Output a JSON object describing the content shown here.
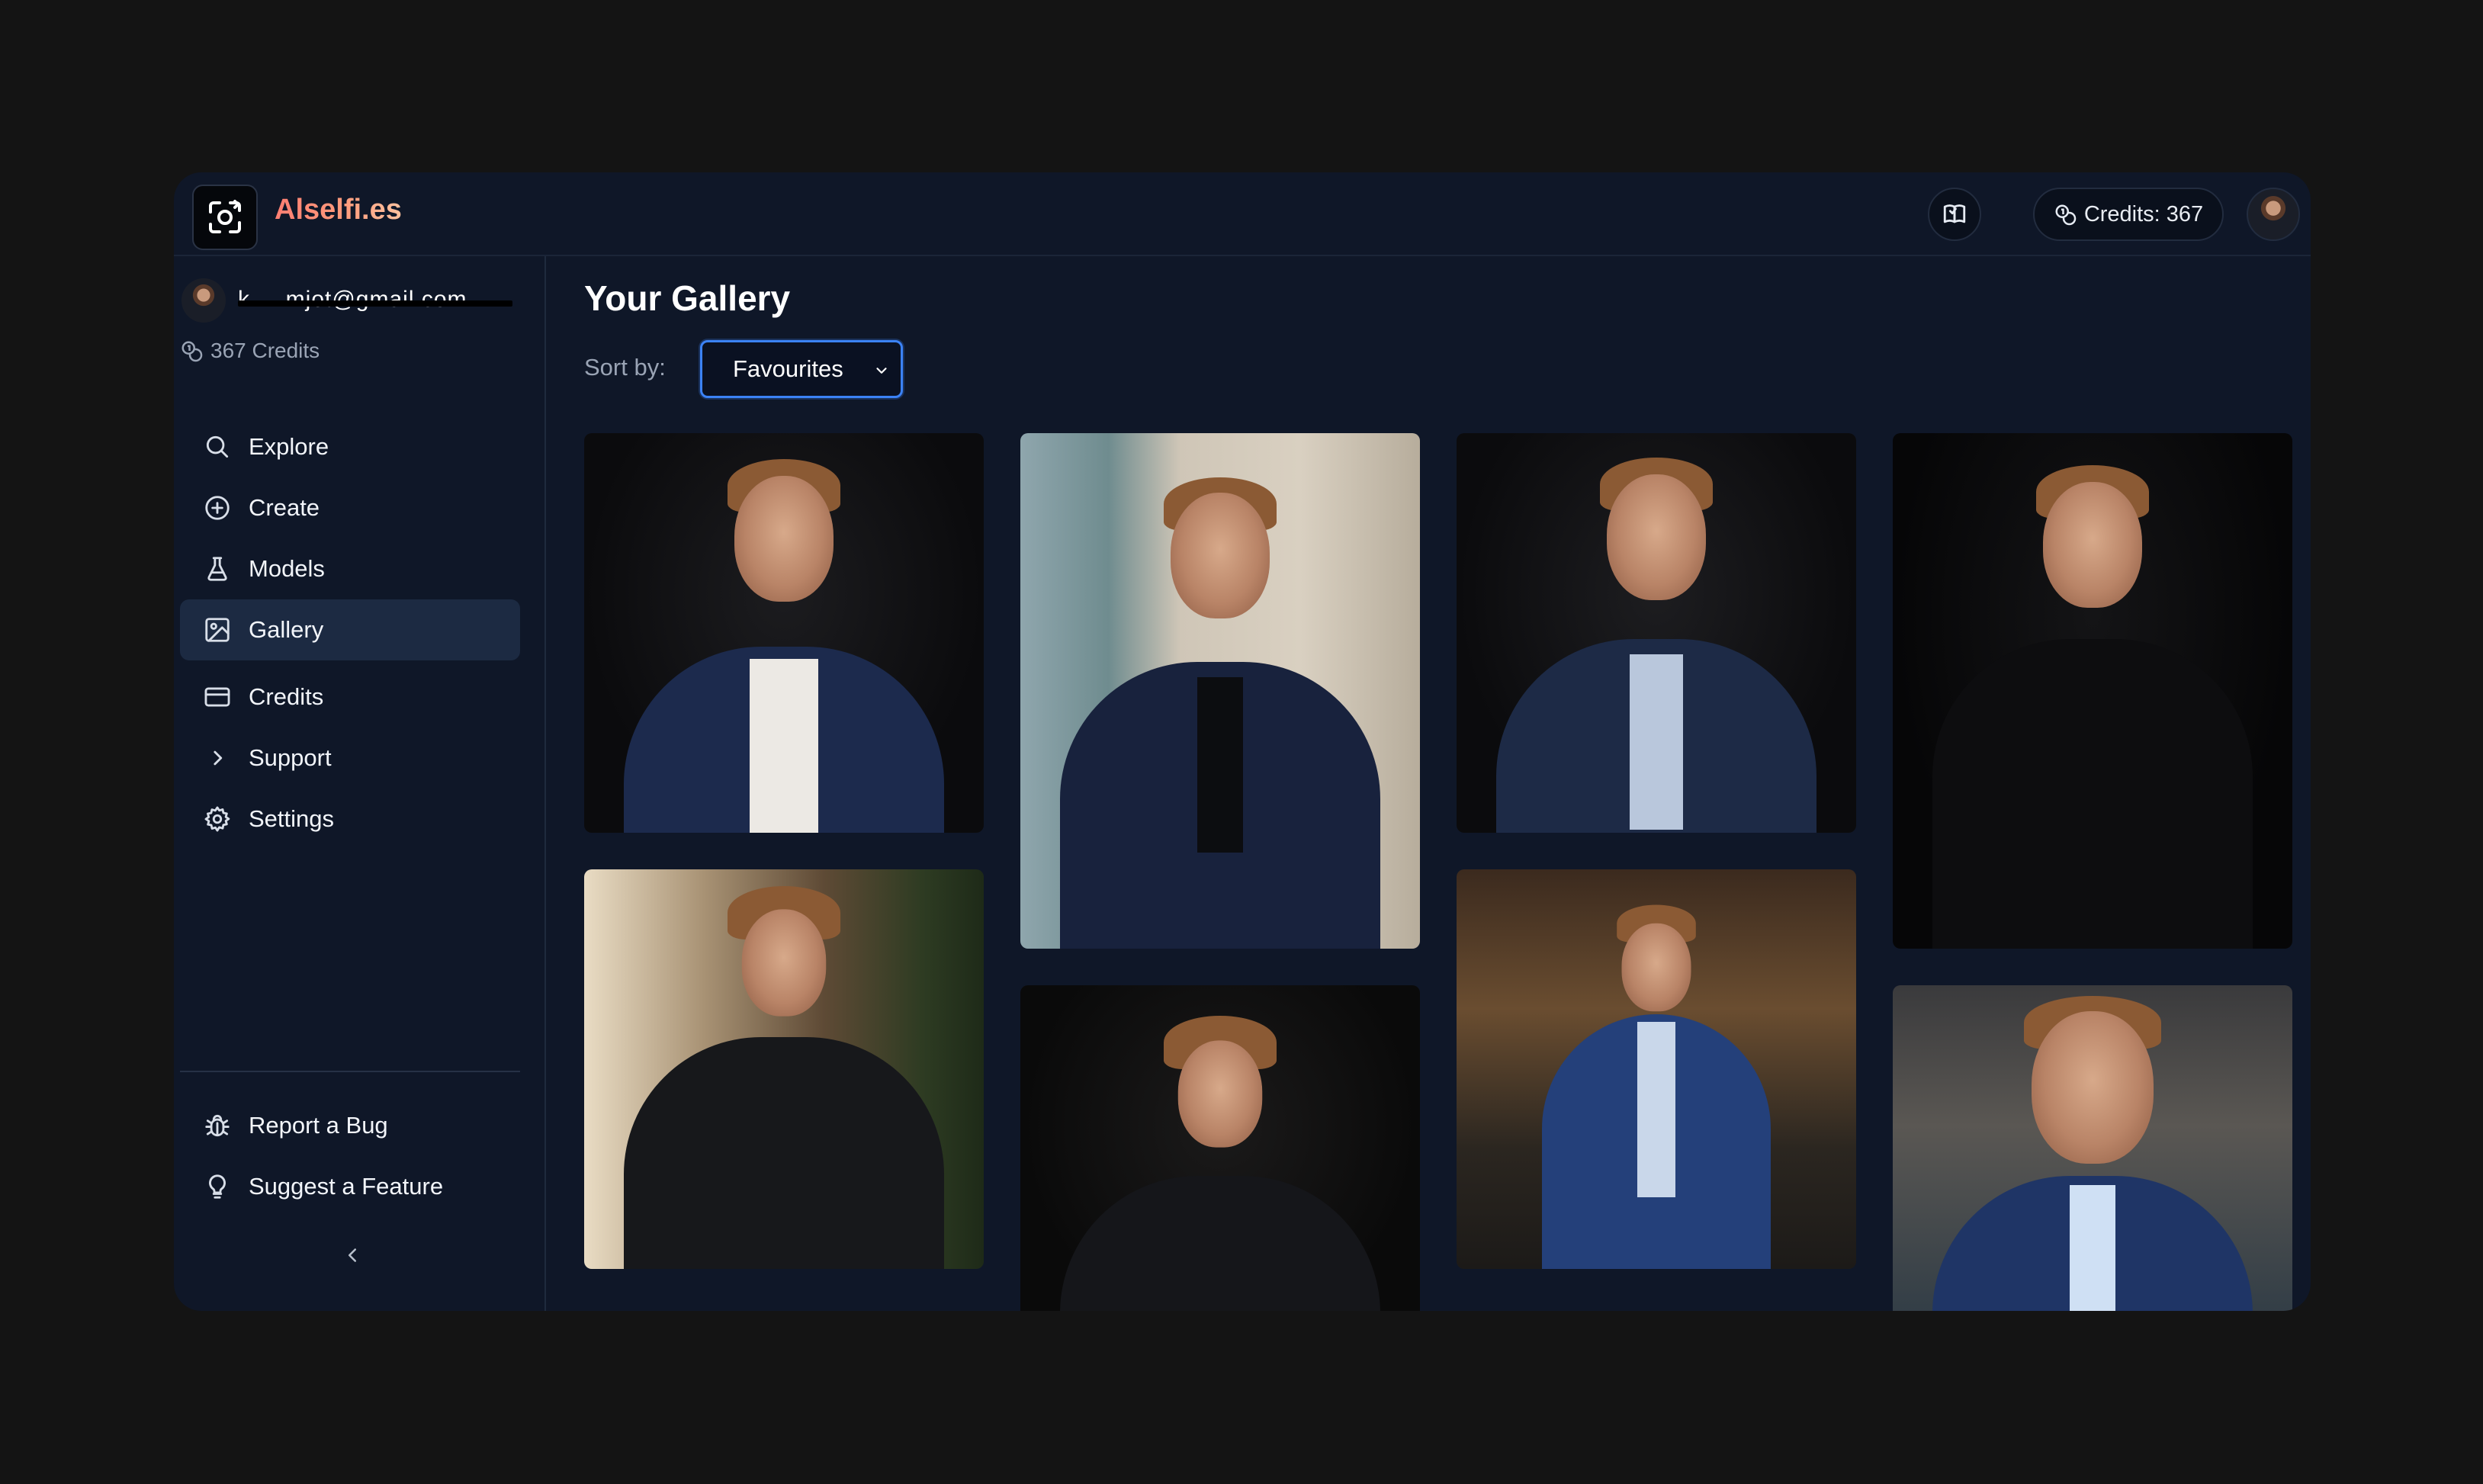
{
  "app": {
    "brand": "Alselfi.es",
    "credits_pill": "Credits: 367",
    "icons": {
      "logo": "camera-swap-icon",
      "header_button": "book-icon",
      "credits": "coins-icon"
    },
    "accent": "#3b82f6",
    "brand_gradient": [
      "#ff7e72",
      "#ffc29f"
    ]
  },
  "sidebar": {
    "user_email": "k.....mjot@gmail.com",
    "credits": "367 Credits",
    "nav": [
      {
        "label": "Explore",
        "icon": "search-icon"
      },
      {
        "label": "Create",
        "icon": "plus-circle-icon"
      },
      {
        "label": "Models",
        "icon": "flask-icon"
      },
      {
        "label": "Gallery",
        "icon": "image-icon",
        "active": true
      },
      {
        "label": "Credits",
        "icon": "credit-card-icon"
      },
      {
        "label": "Support",
        "icon": "chevron-right-icon"
      },
      {
        "label": "Settings",
        "icon": "gear-icon"
      }
    ],
    "secondary": [
      {
        "label": "Report a Bug",
        "icon": "bug-icon"
      },
      {
        "label": "Suggest a Feature",
        "icon": "lightbulb-icon"
      }
    ]
  },
  "main": {
    "title": "Your Gallery",
    "sort_label": "Sort by:",
    "sort_value": "Favourites",
    "photos": [
      {
        "desc": "portrait-navy-blazer-white-tee-dark-bg"
      },
      {
        "desc": "seated-office-window-navy-suit"
      },
      {
        "desc": "portrait-suit-tie-dark-bg"
      },
      {
        "desc": "portrait-black-blazer-dark-bg"
      },
      {
        "desc": "black-turtleneck-restaurant"
      },
      {
        "desc": "portrait-black-jacket-dark-bg"
      },
      {
        "desc": "blue-suit-office-lights"
      },
      {
        "desc": "headshot-blue-suit-office"
      }
    ]
  }
}
